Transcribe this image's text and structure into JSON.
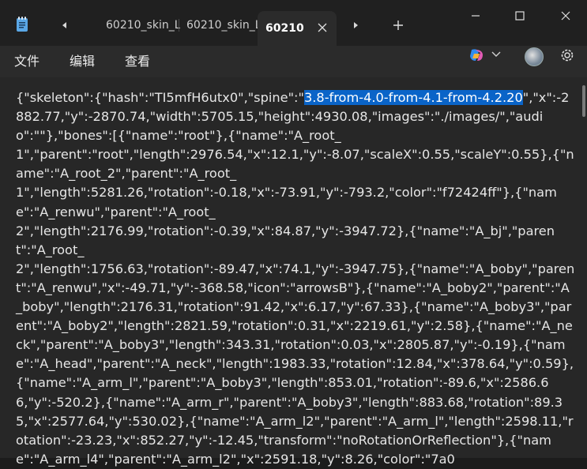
{
  "titlebar": {
    "app_icon": "notepad-icon",
    "tabs": [
      {
        "label": "60210_skin_L"
      },
      {
        "label": "60210_skin_L"
      },
      {
        "label": "60210",
        "active": true
      }
    ],
    "icons": {
      "back": "chevron-left-icon",
      "forward": "chevron-right-icon",
      "new_tab": "plus-icon",
      "minimize": "minimize-icon",
      "maximize": "maximize-icon",
      "close": "close-icon"
    }
  },
  "menubar": {
    "items": [
      "文件",
      "编辑",
      "查看"
    ],
    "icons": [
      "copilot-icon",
      "chevron-down-icon",
      "avatar",
      "gear-icon"
    ]
  },
  "editor": {
    "text_before": "{\"skeleton\":{\"hash\":\"TI5mfH6utx0\",\"spine\":\"",
    "text_selected": "3.8-from-4.0-from-4.1-from-4.2.20",
    "text_after": "\",\"x\":-2882.77,\"y\":-2870.74,\"width\":5705.15,\"height\":4930.08,\"images\":\"./images/\",\"audio\":\"\"},\"bones\":[{\"name\":\"root\"},{\"name\":\"A_root_\n1\",\"parent\":\"root\",\"length\":2976.54,\"x\":12.1,\"y\":-8.07,\"scaleX\":0.55,\"scaleY\":0.55},{\"name\":\"A_root_2\",\"parent\":\"A_root_\n1\",\"length\":5281.26,\"rotation\":-0.18,\"x\":-73.91,\"y\":-793.2,\"color\":\"f72424ff\"},{\"name\":\"A_renwu\",\"parent\":\"A_root_\n2\",\"length\":2176.99,\"rotation\":-0.39,\"x\":84.87,\"y\":-3947.72},{\"name\":\"A_bj\",\"parent\":\"A_root_\n2\",\"length\":1756.63,\"rotation\":-89.47,\"x\":74.1,\"y\":-3947.75},{\"name\":\"A_boby\",\"parent\":\"A_renwu\",\"x\":-49.71,\"y\":-368.58,\"icon\":\"arrowsB\"},{\"name\":\"A_boby2\",\"parent\":\"A_boby\",\"length\":2176.31,\"rotation\":91.42,\"x\":6.17,\"y\":67.33},{\"name\":\"A_boby3\",\"parent\":\"A_boby2\",\"length\":2821.59,\"rotation\":0.31,\"x\":2219.61,\"y\":2.58},{\"name\":\"A_neck\",\"parent\":\"A_boby3\",\"length\":343.31,\"rotation\":0.03,\"x\":2805.87,\"y\":-0.19},{\"name\":\"A_head\",\"parent\":\"A_neck\",\"length\":1983.33,\"rotation\":12.84,\"x\":378.64,\"y\":0.59},{\"name\":\"A_arm_l\",\"parent\":\"A_boby3\",\"length\":853.01,\"rotation\":-89.6,\"x\":2586.66,\"y\":-520.2},{\"name\":\"A_arm_r\",\"parent\":\"A_boby3\",\"length\":883.68,\"rotation\":89.35,\"x\":2577.64,\"y\":530.02},{\"name\":\"A_arm_l2\",\"parent\":\"A_arm_l\",\"length\":2598.11,\"rotation\":-23.23,\"x\":852.27,\"y\":-12.45,\"transform\":\"noRotationOrReflection\"},{\"name\":\"A_arm_l4\",\"parent\":\"A_arm_l2\",\"x\":2591.18,\"y\":8.26,\"color\":\"7a0"
  }
}
